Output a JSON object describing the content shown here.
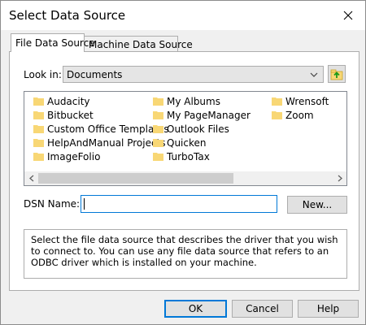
{
  "window": {
    "title": "Select Data Source"
  },
  "tabs": [
    {
      "label": "File Data Source",
      "active": true
    },
    {
      "label": "Machine Data Source",
      "active": false
    }
  ],
  "look_in": {
    "label": "Look in:",
    "value": "Documents"
  },
  "files": [
    "Audacity",
    "Bitbucket",
    "Custom Office Templates",
    "HelpAndManual Projects",
    "ImageFolio",
    "My Albums",
    "My PageManager",
    "Outlook Files",
    "Quicken",
    "TurboTax",
    "Wrensoft",
    "Zoom"
  ],
  "dsn": {
    "label": "DSN Name:",
    "value": ""
  },
  "buttons": {
    "new": "New...",
    "ok": "OK",
    "cancel": "Cancel",
    "help": "Help"
  },
  "description": "Select the file data source that describes the driver that you wish to connect to. You can use any file data source that refers to an ODBC driver which is installed on your machine.",
  "colors": {
    "folder": "#f8d775",
    "accent": "#0078d7"
  }
}
